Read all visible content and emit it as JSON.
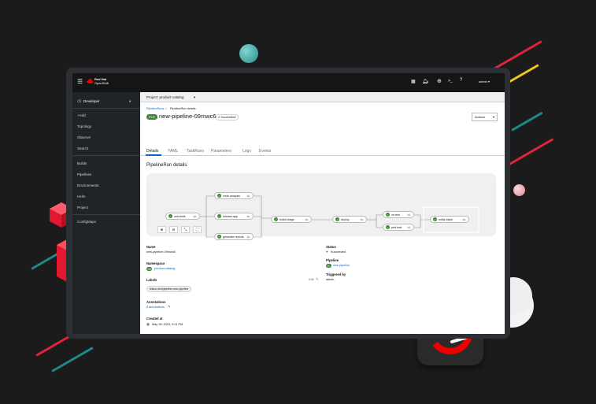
{
  "brand": {
    "line1": "Red Hat",
    "line2": "OpenShift"
  },
  "topbar": {
    "notifications_count": "4",
    "user": "admin ▾"
  },
  "project_bar": {
    "label": "Project: product-catalog",
    "caret": "▾"
  },
  "sidebar": {
    "perspective": "Developer",
    "items": [
      {
        "label": "+Add"
      },
      {
        "label": "Topology"
      },
      {
        "label": "Observe"
      },
      {
        "label": "Search"
      },
      {
        "label": "Builds"
      },
      {
        "label": "Pipelines"
      },
      {
        "label": "Environments"
      },
      {
        "label": "Helm"
      },
      {
        "label": "Project"
      },
      {
        "label": "ConfigMaps"
      }
    ]
  },
  "breadcrumb": {
    "parent": "PipelineRuns",
    "separator": ">",
    "current": "PipelineRun details"
  },
  "header": {
    "badge": "PLR",
    "title": "new-pipeline-09mwc6",
    "status": "Succeeded",
    "actions": "Actions"
  },
  "tabs": [
    {
      "label": "Details"
    },
    {
      "label": "YAML"
    },
    {
      "label": "TaskRuns"
    },
    {
      "label": "Parameters"
    },
    {
      "label": "Logs"
    },
    {
      "label": "Events"
    }
  ],
  "section_title": "PipelineRun details",
  "pipeline_nodes": [
    {
      "name": "unit-tests",
      "time": "6s"
    },
    {
      "name": "code-analysis",
      "time": "6s"
    },
    {
      "name": "release-app",
      "time": "8s"
    },
    {
      "name": "generate-reports",
      "time": "6s"
    },
    {
      "name": "build-image",
      "time": "5s"
    },
    {
      "name": "deploy",
      "time": "6s"
    },
    {
      "name": "int-test",
      "time": "6s"
    },
    {
      "name": "perf-test",
      "time": "6s"
    },
    {
      "name": "notify-slack",
      "time": "6s"
    }
  ],
  "zoom_controls": [
    "⊕",
    "⊖",
    "⤡",
    "⛶"
  ],
  "details": {
    "name_label": "Name",
    "name_value": "new-pipeline-09mwc6",
    "namespace_label": "Namespace",
    "namespace_badge": "NS",
    "namespace_value": "product-catalog",
    "labels_label": "Labels",
    "labels_edit": "Edit",
    "label_chip": "tekton.dev/pipeline=new-pipeline",
    "annotations_label": "Annotations",
    "annotations_value": "8 annotations",
    "created_label": "Created at",
    "created_value": "May 18, 2023, 2:21 PM",
    "status_label": "Status",
    "status_value": "Succeeded",
    "pipeline_label": "Pipeline",
    "pipeline_badge": "PL",
    "pipeline_value": "new-pipeline",
    "triggered_label": "Triggered by",
    "triggered_value": "admin"
  },
  "colors": {
    "accent": "#0066cc",
    "success": "#3e8635",
    "brand_red": "#ee0000",
    "background": "#1b1b1b"
  }
}
